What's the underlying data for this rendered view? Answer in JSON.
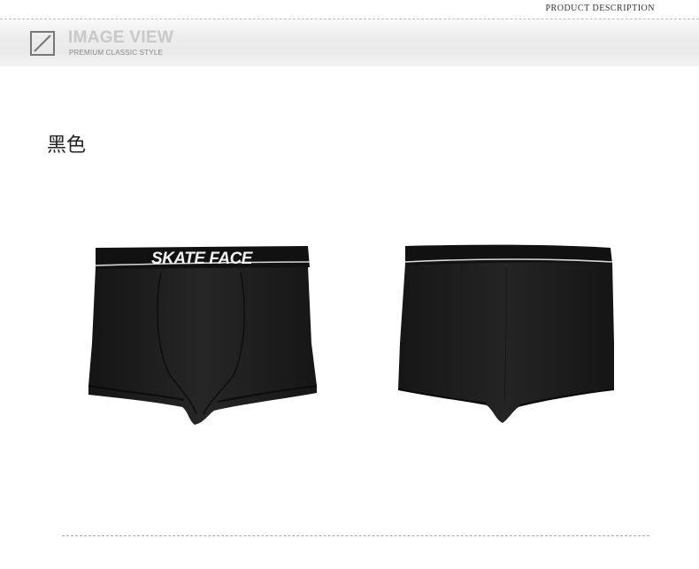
{
  "top_label": "PRODUCT DESCRIPTION",
  "header": {
    "title": "IMAGE VIEW",
    "subtitle": "PREMIUM CLASSIC STYLE"
  },
  "color_label": "黑色",
  "products": [
    {
      "view": "front",
      "logo_text": "SKATE FACE"
    },
    {
      "view": "back"
    }
  ],
  "colors": {
    "garment": "#1e1e1e",
    "waistband": "#111111",
    "header_title": "#c9c9c9"
  }
}
